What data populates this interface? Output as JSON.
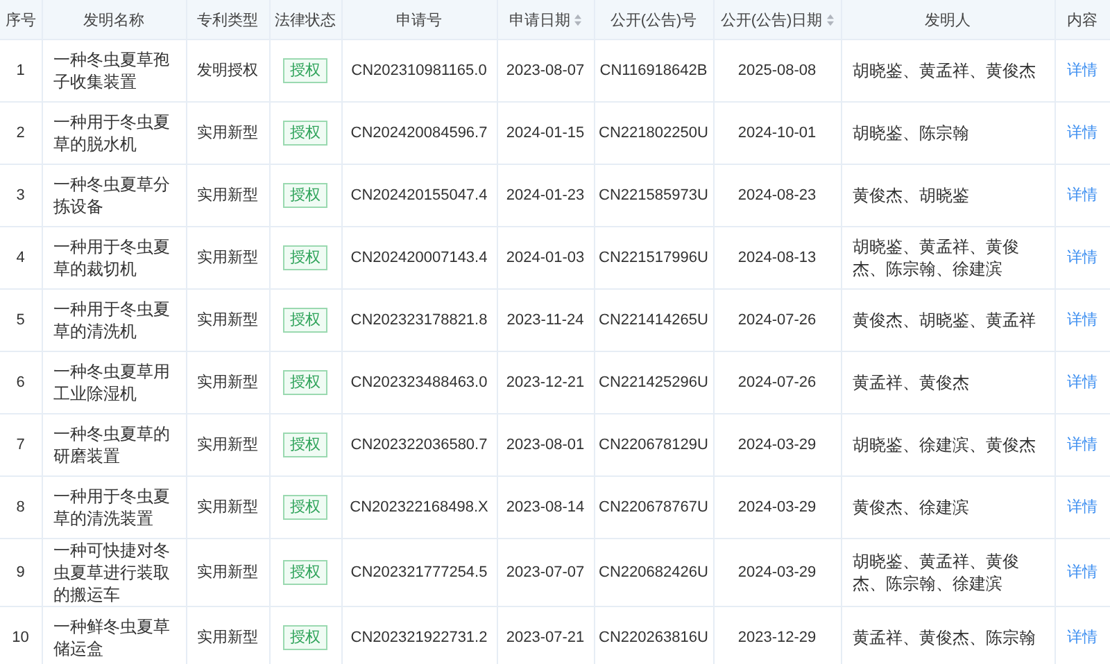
{
  "table": {
    "columns": [
      {
        "label": "序号",
        "sortable": false
      },
      {
        "label": "发明名称",
        "sortable": false
      },
      {
        "label": "专利类型",
        "sortable": false
      },
      {
        "label": "法律状态",
        "sortable": false
      },
      {
        "label": "申请号",
        "sortable": false
      },
      {
        "label": "申请日期",
        "sortable": true
      },
      {
        "label": "公开(公告)号",
        "sortable": false
      },
      {
        "label": "公开(公告)日期",
        "sortable": true
      },
      {
        "label": "发明人",
        "sortable": false
      },
      {
        "label": "内容",
        "sortable": false
      }
    ],
    "rows": [
      {
        "index": "1",
        "name": "一种冬虫夏草孢子收集装置",
        "type": "发明授权",
        "status": "授权",
        "application_no": "CN202310981165.0",
        "application_date": "2023-08-07",
        "publication_no": "CN116918642B",
        "publication_date": "2025-08-08",
        "inventors": "胡晓鉴、黄孟祥、黄俊杰",
        "link": "详情"
      },
      {
        "index": "2",
        "name": "一种用于冬虫夏草的脱水机",
        "type": "实用新型",
        "status": "授权",
        "application_no": "CN202420084596.7",
        "application_date": "2024-01-15",
        "publication_no": "CN221802250U",
        "publication_date": "2024-10-01",
        "inventors": "胡晓鉴、陈宗翰",
        "link": "详情"
      },
      {
        "index": "3",
        "name": "一种冬虫夏草分拣设备",
        "type": "实用新型",
        "status": "授权",
        "application_no": "CN202420155047.4",
        "application_date": "2024-01-23",
        "publication_no": "CN221585973U",
        "publication_date": "2024-08-23",
        "inventors": "黄俊杰、胡晓鉴",
        "link": "详情"
      },
      {
        "index": "4",
        "name": "一种用于冬虫夏草的裁切机",
        "type": "实用新型",
        "status": "授权",
        "application_no": "CN202420007143.4",
        "application_date": "2024-01-03",
        "publication_no": "CN221517996U",
        "publication_date": "2024-08-13",
        "inventors": "胡晓鉴、黄孟祥、黄俊杰、陈宗翰、徐建滨",
        "link": "详情"
      },
      {
        "index": "5",
        "name": "一种用于冬虫夏草的清洗机",
        "type": "实用新型",
        "status": "授权",
        "application_no": "CN202323178821.8",
        "application_date": "2023-11-24",
        "publication_no": "CN221414265U",
        "publication_date": "2024-07-26",
        "inventors": "黄俊杰、胡晓鉴、黄孟祥",
        "link": "详情"
      },
      {
        "index": "6",
        "name": "一种冬虫夏草用工业除湿机",
        "type": "实用新型",
        "status": "授权",
        "application_no": "CN202323488463.0",
        "application_date": "2023-12-21",
        "publication_no": "CN221425296U",
        "publication_date": "2024-07-26",
        "inventors": "黄孟祥、黄俊杰",
        "link": "详情"
      },
      {
        "index": "7",
        "name": "一种冬虫夏草的研磨装置",
        "type": "实用新型",
        "status": "授权",
        "application_no": "CN202322036580.7",
        "application_date": "2023-08-01",
        "publication_no": "CN220678129U",
        "publication_date": "2024-03-29",
        "inventors": "胡晓鉴、徐建滨、黄俊杰",
        "link": "详情"
      },
      {
        "index": "8",
        "name": "一种用于冬虫夏草的清洗装置",
        "type": "实用新型",
        "status": "授权",
        "application_no": "CN202322168498.X",
        "application_date": "2023-08-14",
        "publication_no": "CN220678767U",
        "publication_date": "2024-03-29",
        "inventors": "黄俊杰、徐建滨",
        "link": "详情"
      },
      {
        "index": "9",
        "name": "一种可快捷对冬虫夏草进行装取的搬运车",
        "type": "实用新型",
        "status": "授权",
        "application_no": "CN202321777254.5",
        "application_date": "2023-07-07",
        "publication_no": "CN220682426U",
        "publication_date": "2024-03-29",
        "inventors": "胡晓鉴、黄孟祥、黄俊杰、陈宗翰、徐建滨",
        "link": "详情"
      },
      {
        "index": "10",
        "name": "一种鲜冬虫夏草储运盒",
        "type": "实用新型",
        "status": "授权",
        "application_no": "CN202321922731.2",
        "application_date": "2023-07-21",
        "publication_no": "CN220263816U",
        "publication_date": "2023-12-29",
        "inventors": "黄孟祥、黄俊杰、陈宗翰",
        "link": "详情"
      }
    ]
  }
}
